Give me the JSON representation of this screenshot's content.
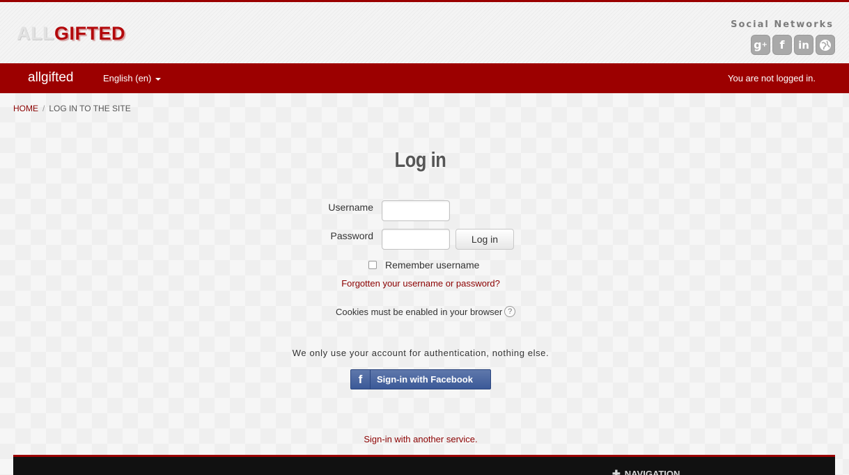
{
  "header": {
    "logo_part1": "ALL",
    "logo_part2": "GIFTED",
    "social_title": "Social Networks",
    "social_icons": [
      "google-plus-icon",
      "facebook-icon",
      "linkedin-icon",
      "globe-icon"
    ]
  },
  "navbar": {
    "brand": "allgifted",
    "language": "English (en)",
    "status": "You are not logged in."
  },
  "breadcrumb": {
    "home": "HOME",
    "current": "LOG IN TO THE SITE"
  },
  "login": {
    "title": "Log in",
    "username_label": "Username",
    "password_label": "Password",
    "submit_label": "Log in",
    "remember_label": "Remember username",
    "forgot_link": "Forgotten your username or password?",
    "cookies_notice": "Cookies must be enabled in your browser"
  },
  "oauth": {
    "note": "We only use your account for authentication, nothing else.",
    "facebook_label": "Sign-in with Facebook",
    "other_service": "Sign-in with another service."
  },
  "footer": {
    "navigation_label": "NAVIGATION"
  },
  "colors": {
    "brand": "#9c0000",
    "link": "#8b0000",
    "facebook": "#3b5998"
  }
}
